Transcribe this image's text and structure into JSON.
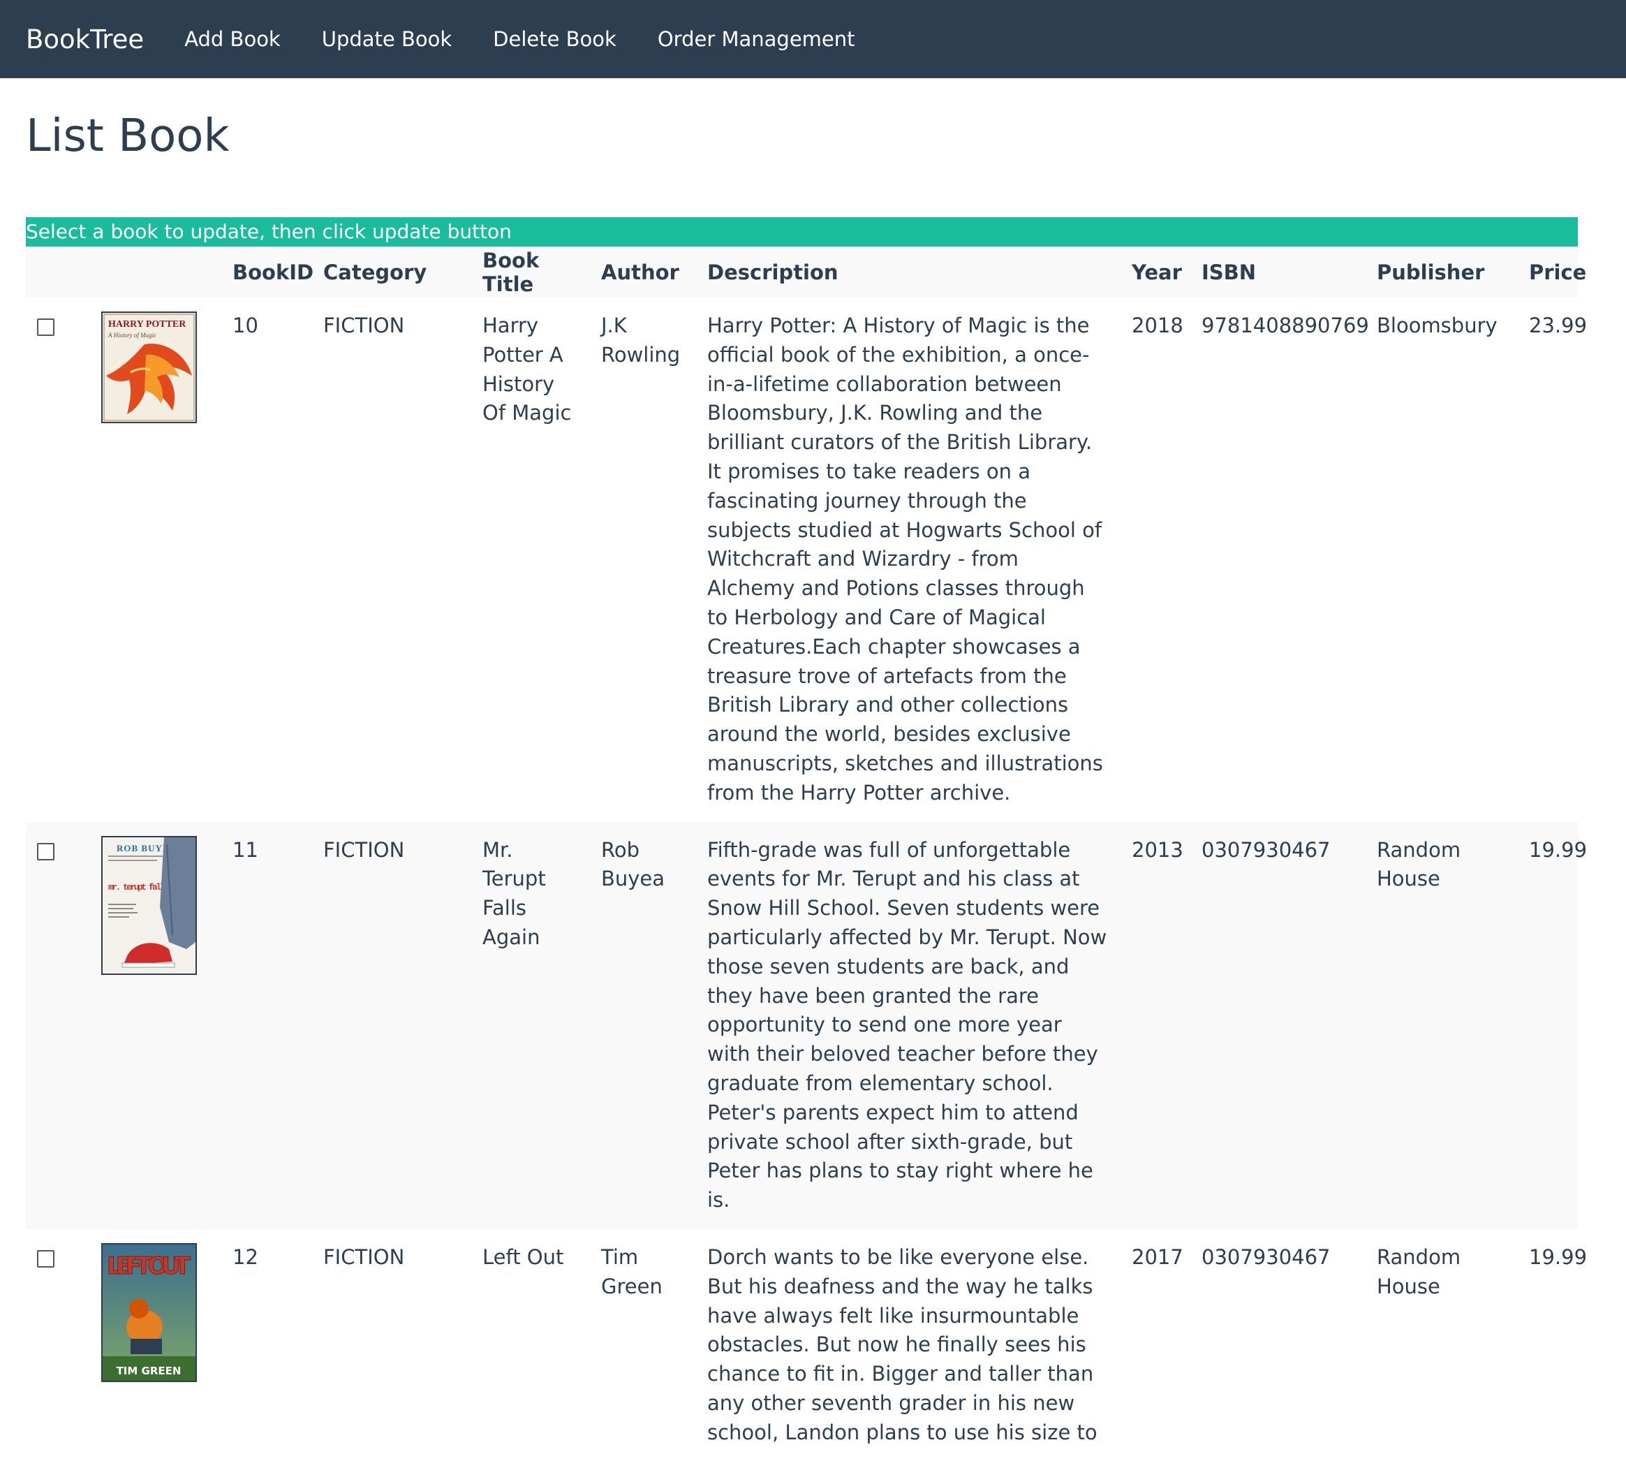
{
  "nav": {
    "brand": "BookTree",
    "links": [
      "Add Book",
      "Update Book",
      "Delete Book",
      "Order Management"
    ]
  },
  "page": {
    "title": "List Book",
    "notice": "Select a book to update, then click update button"
  },
  "table": {
    "headers": [
      "",
      "",
      "BookID",
      "Category",
      "Book Title",
      "Author",
      "Description",
      "Year",
      "ISBN",
      "Publisher",
      "Price"
    ],
    "rows": [
      {
        "id": "10",
        "category": "FICTION",
        "title": "Harry Potter A History Of Magic",
        "author": "J.K Rowling",
        "description": "Harry Potter: A History of Magic is the official book of the exhibition, a once-in-a-lifetime collaboration between Bloomsbury, J.K. Rowling and the brilliant curators of the British Library. It promises to take readers on a fascinating journey through the subjects studied at Hogwarts School of Witchcraft and Wizardry - from Alchemy and Potions classes through to Herbology and Care of Magical Creatures.Each chapter showcases a treasure trove of artefacts from the British Library and other collections around the world, besides exclusive manuscripts, sketches and illustrations from the Harry Potter archive.",
        "year": "2018",
        "isbn": "9781408890769",
        "publisher": "Bloomsbury",
        "price": "23.99",
        "cover_text_1": "HARRY POTTER",
        "cover_text_2": "A History of Magic"
      },
      {
        "id": "11",
        "category": "FICTION",
        "title": "Mr. Terupt Falls Again",
        "author": "Rob Buyea",
        "description": "Fifth-grade was full of unforgettable events for Mr. Terupt and his class at Snow Hill School. Seven students were particularly affected by Mr. Terupt. Now those seven students are back, and they have been granted the rare opportunity to send one more year with their beloved teacher before they graduate from elementary school. Peter's parents expect him to attend private school after sixth-grade, but Peter has plans to stay right where he is.",
        "year": "2013",
        "isbn": "0307930467",
        "publisher": "Random House",
        "price": "19.99",
        "cover_text_1": "ROB BUYEA",
        "cover_text_2": "mr. terupt falls again"
      },
      {
        "id": "12",
        "category": "FICTION",
        "title": "Left Out",
        "author": "Tim Green",
        "description": "Dorch wants to be like everyone else. But his deafness and the way he talks have always felt like insurmountable obstacles. But now he finally sees his chance to fit in. Bigger and taller than any other seventh grader in his new school, Landon plans to use his size to",
        "year": "2017",
        "isbn": "0307930467",
        "publisher": "Random House",
        "price": "19.99",
        "cover_text_1": "LEFT OUT",
        "cover_text_2": "TIM GREEN"
      }
    ]
  }
}
